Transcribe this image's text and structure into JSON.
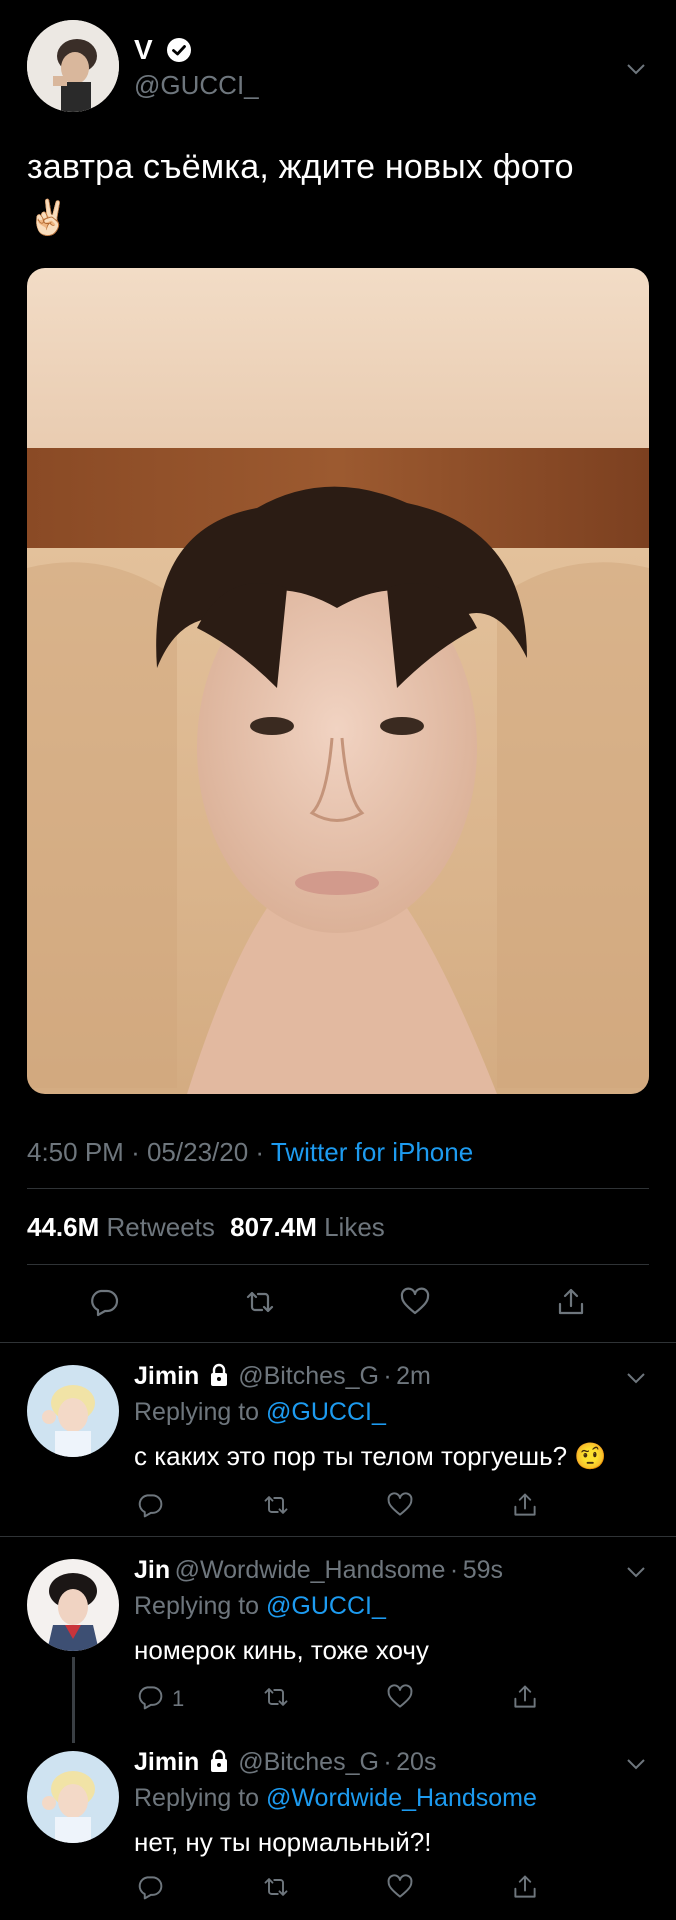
{
  "tweet": {
    "author_name": "V",
    "author_handle": "@GUCCI_",
    "text": "завтра съёмка, ждите новых фото",
    "emoji": "✌🏻",
    "time": "4:50 PM",
    "dot1": "·",
    "date": "05/23/20",
    "dot2": "·",
    "source": "Twitter for iPhone",
    "retweets_count": "44.6M",
    "retweets_label": "Retweets",
    "likes_count": "807.4M",
    "likes_label": "Likes"
  },
  "replies": [
    {
      "name": "Jimin",
      "handle": "@Bitches_G",
      "sep": "·",
      "time": "2m",
      "replying_label": "Replying to",
      "replying_to": "@GUCCI_",
      "text": "с каких это пор ты телом торгуешь?",
      "emoji": "🤨"
    },
    {
      "name": "Jin",
      "handle": "@Wordwide_Handsome",
      "sep": "·",
      "time": "59s",
      "replying_label": "Replying to",
      "replying_to": "@GUCCI_",
      "text": "номерок кинь, тоже хочу",
      "reply_count": "1"
    },
    {
      "name": "Jimin",
      "handle": "@Bitches_G",
      "sep": "·",
      "time": "20s",
      "replying_label": "Replying to",
      "replying_to": "@Wordwide_Handsome",
      "text": "нет, ну ты нормальный?!"
    }
  ],
  "icons": {
    "verified": "verified-badge-icon",
    "lock": "lock-icon",
    "reply": "reply-icon",
    "retweet": "retweet-icon",
    "like": "heart-icon",
    "share": "share-icon",
    "chevron": "chevron-down-icon"
  },
  "colors": {
    "background": "#000000",
    "link": "#1d9bf0",
    "muted": "#6e767d",
    "divider": "#2f3336"
  }
}
